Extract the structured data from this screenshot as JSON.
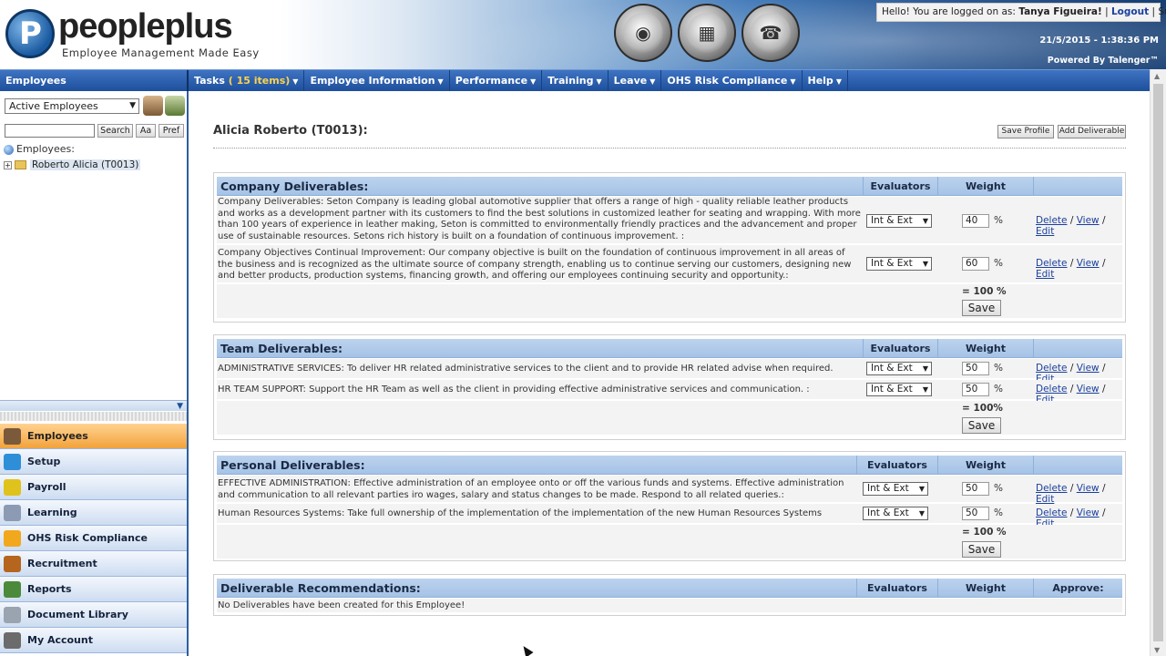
{
  "header": {
    "logo_name": "peopleplus",
    "tagline": "Employee Management Made Easy",
    "greeting": "Hello! You are logged on as:",
    "user_name": "Tanya Figueira!",
    "logout": "Logout",
    "support": "Support",
    "datetime": "21/5/2015 - 1:38:36 PM",
    "powered_by": "Powered By Talenger™",
    "icons": [
      "camera-icon",
      "books-icon",
      "headset-icon"
    ]
  },
  "nav": {
    "left_title": "Employees",
    "items": [
      {
        "label": "Tasks",
        "count": "( 15 items)"
      },
      {
        "label": "Employee Information"
      },
      {
        "label": "Performance"
      },
      {
        "label": "Training"
      },
      {
        "label": "Leave"
      },
      {
        "label": "OHS Risk Compliance"
      },
      {
        "label": "Help"
      }
    ]
  },
  "sidebar": {
    "filter_value": "Active Employees",
    "search_btn": "Search",
    "aa_btn": "Aa",
    "pref_btn": "Pref",
    "tree_root": "Employees:",
    "tree_node": "Roberto Alicia (T0013)",
    "modules": [
      {
        "label": "Employees",
        "active": true,
        "color": "#7a5a3a"
      },
      {
        "label": "Setup",
        "color": "#2e8fd8"
      },
      {
        "label": "Payroll",
        "color": "#e0c21c"
      },
      {
        "label": "Learning",
        "color": "#8c9bb3"
      },
      {
        "label": "OHS Risk Compliance",
        "color": "#f2a81d"
      },
      {
        "label": "Recruitment",
        "color": "#b5651d"
      },
      {
        "label": "Reports",
        "color": "#4b8a3a"
      },
      {
        "label": "Document Library",
        "color": "#9aa4b1"
      },
      {
        "label": "My Account",
        "color": "#6b6b6b"
      }
    ]
  },
  "page": {
    "title": "Alicia Roberto (T0013):",
    "save_profile": "Save Profile",
    "add_deliverable": "Add Deliverable",
    "col_evaluators": "Evaluators",
    "col_weight": "Weight",
    "col_approve": "Approve:",
    "save": "Save",
    "delete": "Delete",
    "view": "View",
    "edit": "Edit",
    "pct": "%"
  },
  "sections": {
    "company": {
      "title": "Company Deliverables:",
      "rows": [
        {
          "text": "Company Deliverables: Seton Company is leading global automotive supplier that offers a range of high - quality reliable leather products and works as a development partner with its customers to find the best solutions in customized leather for seating and wrapping. With more than 100 years of experience in leather making, Seton is committed to environmentally friendly practices and the advancement and proper use of sustainable resources. Setons rich history is built on a foundation of continuous improvement. :",
          "evaluator": "Int & Ext",
          "weight": "40"
        },
        {
          "text": "Company Objectives Continual Improvement: Our company objective is built on the foundation of continuous improvement in all areas of the business and is recognized as the ultimate source of company strength, enabling us to continue serving our customers, designing new and better products, production systems, financing growth, and offering our employees continuing security and opportunity.:",
          "evaluator": "Int & Ext",
          "weight": "60"
        }
      ],
      "total": "= 100 %"
    },
    "team": {
      "title": "Team Deliverables:",
      "rows": [
        {
          "text": "ADMINISTRATIVE SERVICES: To deliver HR related administrative services to the client and to provide HR related advise when required.",
          "evaluator": "Int & Ext",
          "weight": "50"
        },
        {
          "text": "HR TEAM SUPPORT: Support the HR Team as well as the client in providing effective administrative services and communication. :",
          "evaluator": "Int & Ext",
          "weight": "50"
        }
      ],
      "total": "= 100%"
    },
    "personal": {
      "title": "Personal Deliverables:",
      "rows": [
        {
          "text": "EFFECTIVE ADMINISTRATION: Effective administration of an employee onto or off the various funds and systems. Effective administration and communication to all relevant parties iro wages, salary and status changes to be made. Respond to all related queries.:",
          "evaluator": "Int & Ext",
          "weight": "50"
        },
        {
          "text": "Human Resources Systems: Take full ownership of the implementation of the implementation of the new Human Resources Systems",
          "evaluator": "Int & Ext",
          "weight": "50"
        }
      ],
      "total": "= 100 %"
    },
    "recommend": {
      "title": "Deliverable Recommendations:",
      "empty": "No Deliverables have been created for this Employee!"
    }
  }
}
